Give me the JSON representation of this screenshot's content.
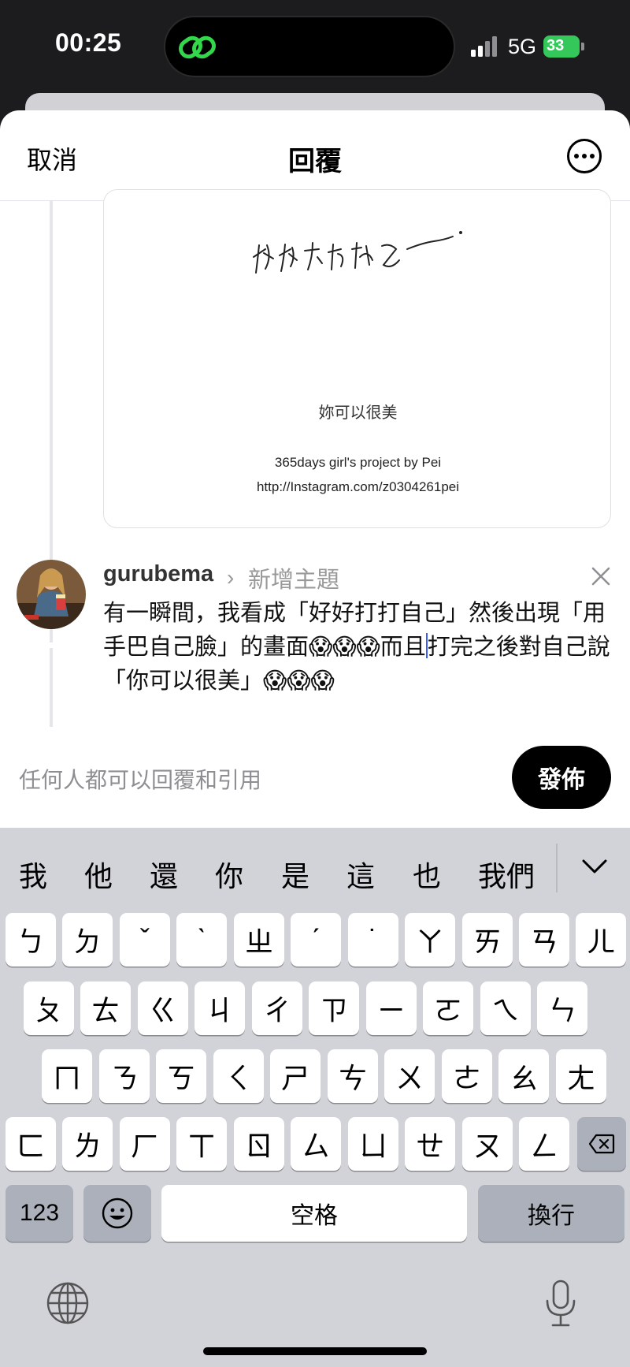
{
  "status_bar": {
    "time": "00:25",
    "network": "5G",
    "battery": "33"
  },
  "header": {
    "cancel": "取消",
    "title": "回覆"
  },
  "quoted_post": {
    "line1": "妳可以很美",
    "line2": "365days girl's project by Pei",
    "line3": "http://Instagram.com/z0304261pei"
  },
  "compose": {
    "username": "gurubema",
    "chevron": "›",
    "add_topic": "新增主題",
    "text_before_caret": "有一瞬間，我看成「好好打打自己」然後出現「用手巴自己臉」的畫面😱😱😱而且",
    "text_after_caret": "打完之後對自己說「你可以很美」😱😱😱"
  },
  "footer": {
    "reply_permission": "任何人都可以回覆和引用",
    "post_button": "發佈"
  },
  "keyboard": {
    "candidates": [
      "我",
      "他",
      "還",
      "你",
      "是",
      "這",
      "也",
      "我們"
    ],
    "row1": [
      "ㄅ",
      "ㄉ",
      "ˇ",
      "ˋ",
      "ㄓ",
      "ˊ",
      "˙",
      "ㄚ",
      "ㄞ",
      "ㄢ",
      "ㄦ"
    ],
    "row2": [
      "ㄆ",
      "ㄊ",
      "ㄍ",
      "ㄐ",
      "ㄔ",
      "ㄗ",
      "ㄧ",
      "ㄛ",
      "ㄟ",
      "ㄣ"
    ],
    "row3": [
      "ㄇ",
      "ㄋ",
      "ㄎ",
      "ㄑ",
      "ㄕ",
      "ㄘ",
      "ㄨ",
      "ㄜ",
      "ㄠ",
      "ㄤ"
    ],
    "row4": [
      "ㄈ",
      "ㄌ",
      "ㄏ",
      "ㄒ",
      "ㄖ",
      "ㄙ",
      "ㄩ",
      "ㄝ",
      "ㄡ",
      "ㄥ"
    ],
    "numbers_key": "123",
    "space_key": "空格",
    "return_key": "換行"
  },
  "icons": {
    "island_app": "threads-link-icon",
    "more": "more-options-icon",
    "close": "close-icon",
    "delete": "backspace-icon",
    "emoji": "emoji-icon",
    "globe": "globe-icon",
    "mic": "microphone-icon",
    "collapse": "chevron-down-icon"
  },
  "colors": {
    "caret": "#3b5bfd",
    "island_icon": "#32d74b",
    "battery": "#34c759"
  }
}
